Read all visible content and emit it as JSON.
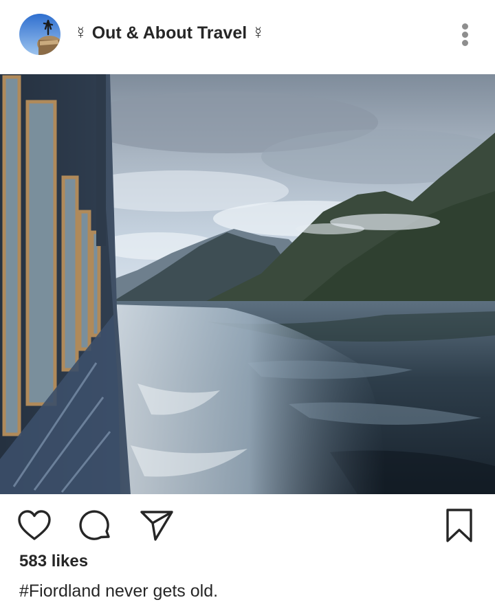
{
  "post": {
    "account_name": "☿ Out & About Travel ☿",
    "likes_count": "583",
    "likes_unit": "likes",
    "caption": "#Fiordland never gets old."
  },
  "icons": {
    "more": "more-vertical-icon",
    "like": "heart-icon",
    "comment": "comment-bubble-icon",
    "share": "paper-plane-icon",
    "save": "bookmark-icon"
  },
  "colors": {
    "text": "#262626",
    "icon": "#262626",
    "more_dots": "#8e8e8e",
    "background": "#ffffff"
  }
}
